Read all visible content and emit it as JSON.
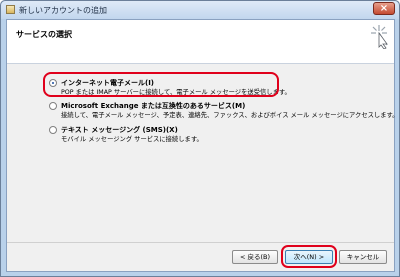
{
  "window": {
    "title": "新しいアカウントの追加"
  },
  "header": {
    "section_title": "サービスの選択"
  },
  "options": [
    {
      "title": "インターネット電子メール(I)",
      "desc": "POP または IMAP サーバーに接続して、電子メール メッセージを送受信します。",
      "selected": true
    },
    {
      "title": "Microsoft Exchange または互換性のあるサービス(M)",
      "desc": "接続して、電子メール メッセージ、予定表、連絡先、ファックス、およびボイス メール メッセージにアクセスします。",
      "selected": false
    },
    {
      "title": "テキスト メッセージング (SMS)(X)",
      "desc": "モバイル メッセージング サービスに接続します。",
      "selected": false
    }
  ],
  "buttons": {
    "back": "< 戻る(B)",
    "next": "次へ(N) >",
    "cancel": "キャンセル"
  },
  "colors": {
    "highlight": "#e0001b",
    "titlebar": "#c2d6ee"
  }
}
